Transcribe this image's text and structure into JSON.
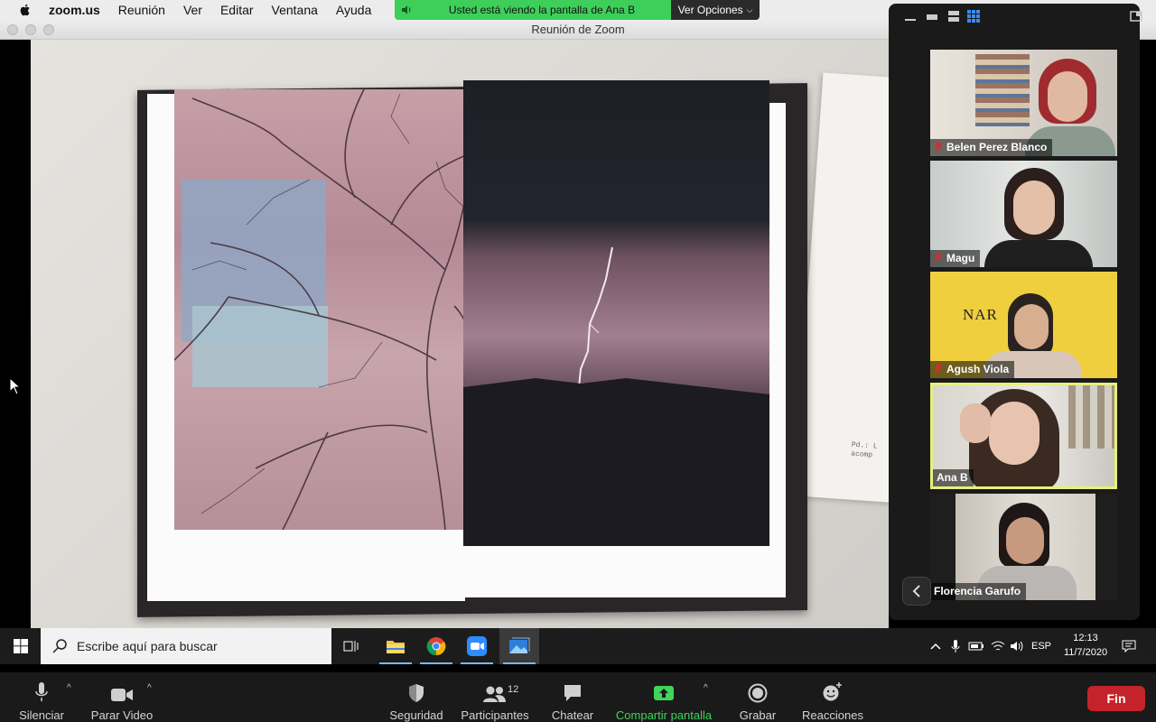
{
  "menubar": {
    "app_name": "zoom.us",
    "items": [
      "Reunión",
      "Ver",
      "Editar",
      "Ventana",
      "Ayuda"
    ]
  },
  "share_banner": {
    "text": "Usted está viendo la pantalla de Ana B",
    "options_label": "Ver Opciones"
  },
  "window": {
    "title": "Reunión de Zoom"
  },
  "shared_paper_text": "Pd.: L\nacomp",
  "participants": [
    {
      "name": "Belen Perez Blanco",
      "muted": true,
      "active": false
    },
    {
      "name": "Magu",
      "muted": true,
      "active": false
    },
    {
      "name": "Agush Viola",
      "muted": true,
      "active": false
    },
    {
      "name": "Ana B",
      "muted": false,
      "active": true
    },
    {
      "name": "Florencia Garufo",
      "muted": false,
      "active": false
    }
  ],
  "taskbar": {
    "search_placeholder": "Escribe aquí para buscar",
    "language": "ESP",
    "time": "12:13",
    "date": "11/7/2020"
  },
  "toolbar": {
    "mute_label": "Silenciar",
    "video_label": "Parar Video",
    "security_label": "Seguridad",
    "participants_label": "Participantes",
    "participants_count": "12",
    "chat_label": "Chatear",
    "share_label": "Compartir pantalla",
    "record_label": "Grabar",
    "reactions_label": "Reacciones",
    "end_label": "Fin"
  },
  "colors": {
    "share_green": "#3ecf5a",
    "active_speaker_border": "#e6f07c",
    "end_red": "#c5232b",
    "share_label_green": "#3fd45c"
  }
}
